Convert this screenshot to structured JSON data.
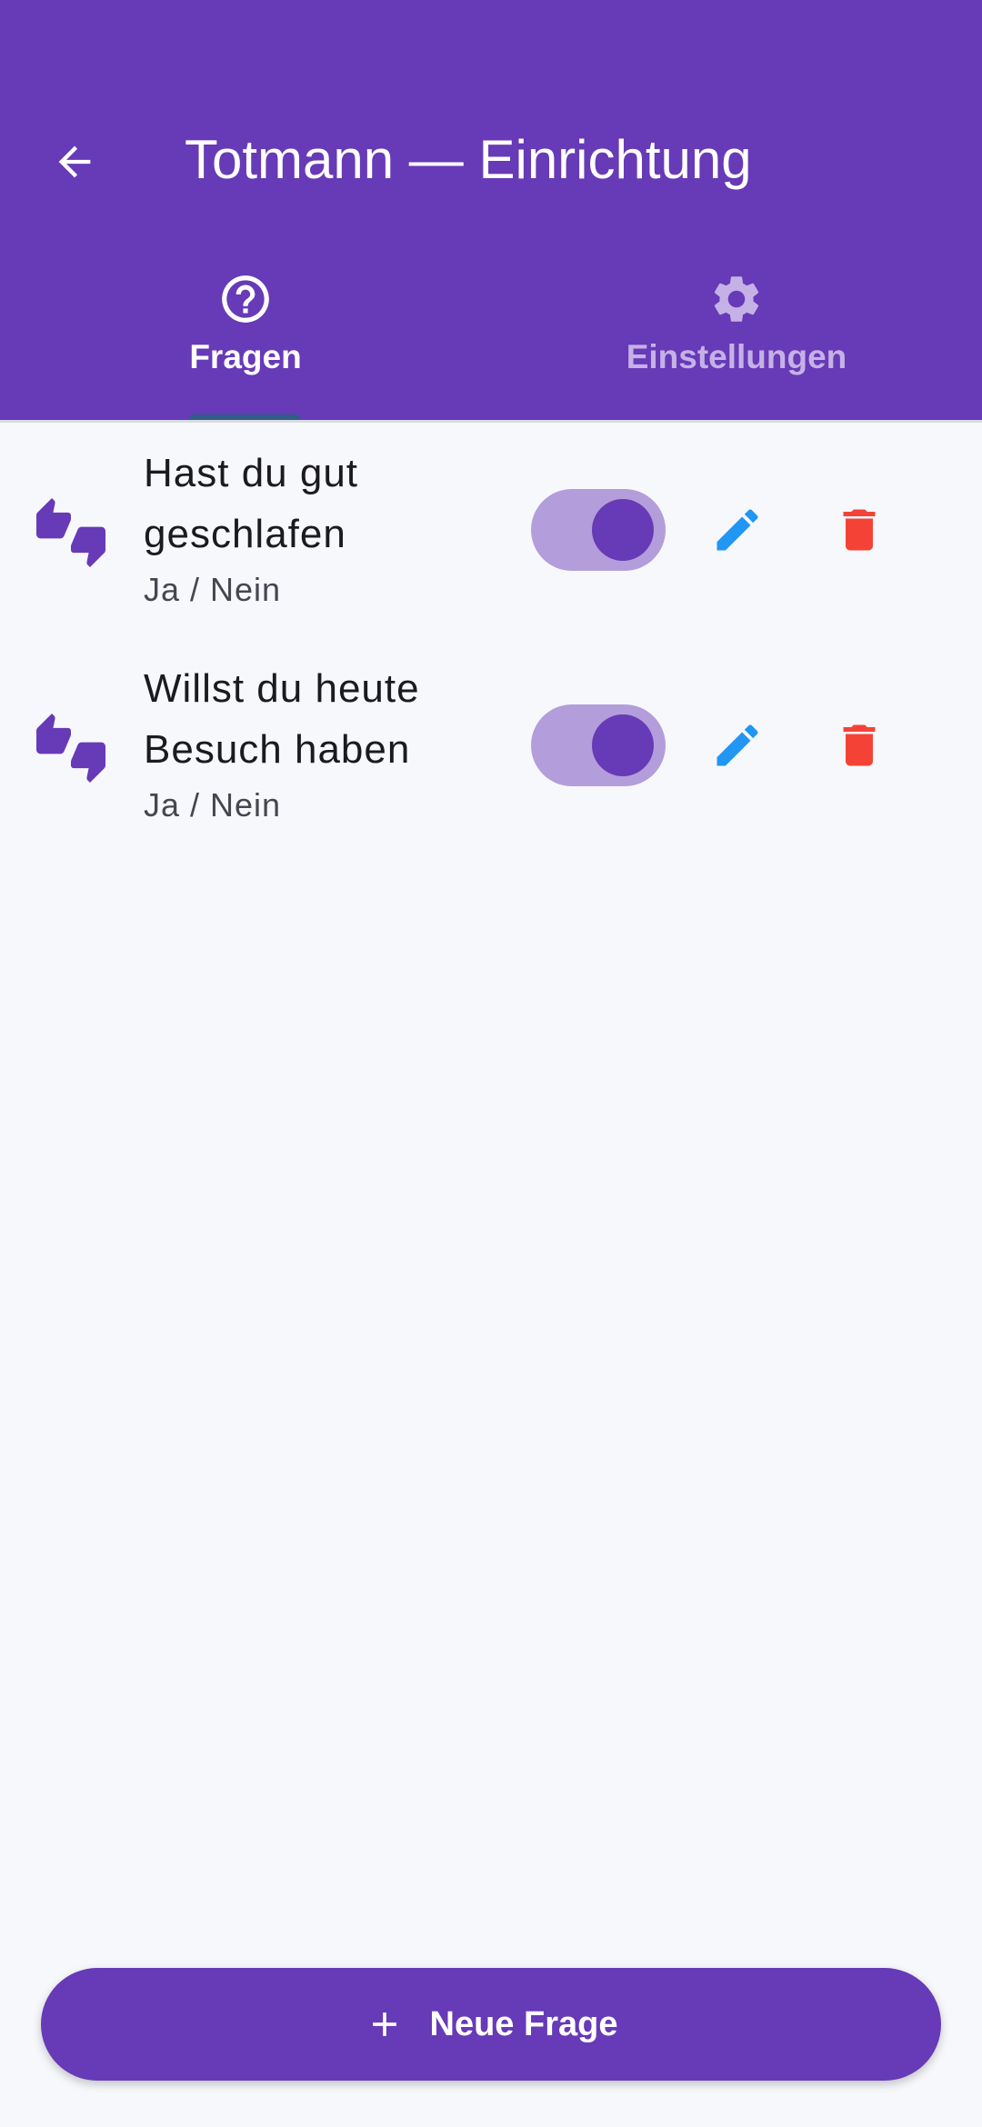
{
  "appbar": {
    "title": "Totmann — Einrichtung",
    "back_icon": "arrow-back-icon",
    "color": "#673ab7"
  },
  "tabs": [
    {
      "label": "Fragen",
      "icon": "help-circle-icon",
      "selected": true
    },
    {
      "label": "Einstellungen",
      "icon": "gear-icon",
      "selected": false
    }
  ],
  "questions": [
    {
      "title_lines": [
        "Hast du gut",
        "geschlafen"
      ],
      "type": "Ja / Nein",
      "enabled": true
    },
    {
      "title_lines": [
        "Willst du heute",
        "Besuch haben"
      ],
      "type": "Ja / Nein",
      "enabled": true
    }
  ],
  "fab": {
    "label": "Neue Frage",
    "icon": "plus-icon"
  },
  "colors": {
    "primary": "#673ab7",
    "edit": "#2196f3",
    "delete": "#f44336",
    "switch_track": "#b39ddb"
  }
}
